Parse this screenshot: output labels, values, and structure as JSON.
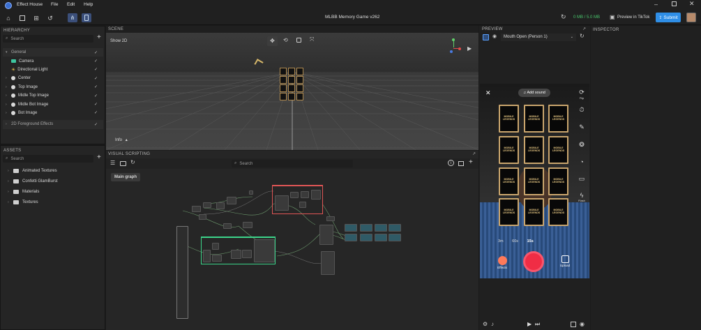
{
  "app": {
    "name": "Effect House",
    "project_title": "MLBB Memory Game v262"
  },
  "menu": {
    "file": "File",
    "edit": "Edit",
    "help": "Help"
  },
  "toolbar": {
    "size": "0 MB / 5.0 MB",
    "preview_tiktok": "Preview in TikTok",
    "submit": "Submit"
  },
  "hierarchy": {
    "title": "HIERARCHY",
    "search_placeholder": "Search",
    "items": [
      {
        "label": "General",
        "type": "group"
      },
      {
        "label": "Camera",
        "type": "camera"
      },
      {
        "label": "Directional Light",
        "type": "light"
      },
      {
        "label": "Center",
        "type": "object"
      },
      {
        "label": "Top Image",
        "type": "object"
      },
      {
        "label": "Midle Top Image",
        "type": "object"
      },
      {
        "label": "Midle Bot Image",
        "type": "object"
      },
      {
        "label": "Bot Image",
        "type": "object"
      }
    ],
    "foreground_group": "2D Foreground Effects"
  },
  "assets": {
    "title": "ASSETS",
    "search_placeholder": "Search",
    "folders": [
      "Animated Textures",
      "Confetti GlamBurst",
      "Materials",
      "Textures"
    ]
  },
  "scene": {
    "title": "SCENE",
    "show2d": "Show 2D",
    "info": "Info"
  },
  "visual_scripting": {
    "title": "VISUAL SCRIPTING",
    "search_placeholder": "Search",
    "tab": "Main graph"
  },
  "preview": {
    "title": "PREVIEW",
    "trigger": "Mouth Open (Person 1)",
    "add_sound": "Add sound",
    "durations": [
      "3m",
      "60s",
      "15s"
    ],
    "selected_duration": "15s",
    "card_label": "MOBILE LEGENDS",
    "side_buttons": [
      "Flip",
      "",
      "",
      "",
      "",
      "",
      "Flash"
    ],
    "effects": "Effects",
    "upload": "Upload"
  },
  "inspector": {
    "title": "INSPECTOR"
  },
  "colors": {
    "accent": "#2f8ee6",
    "size_green": "#49c46b",
    "record": "#f02d45",
    "card_border": "#c9a56d"
  }
}
